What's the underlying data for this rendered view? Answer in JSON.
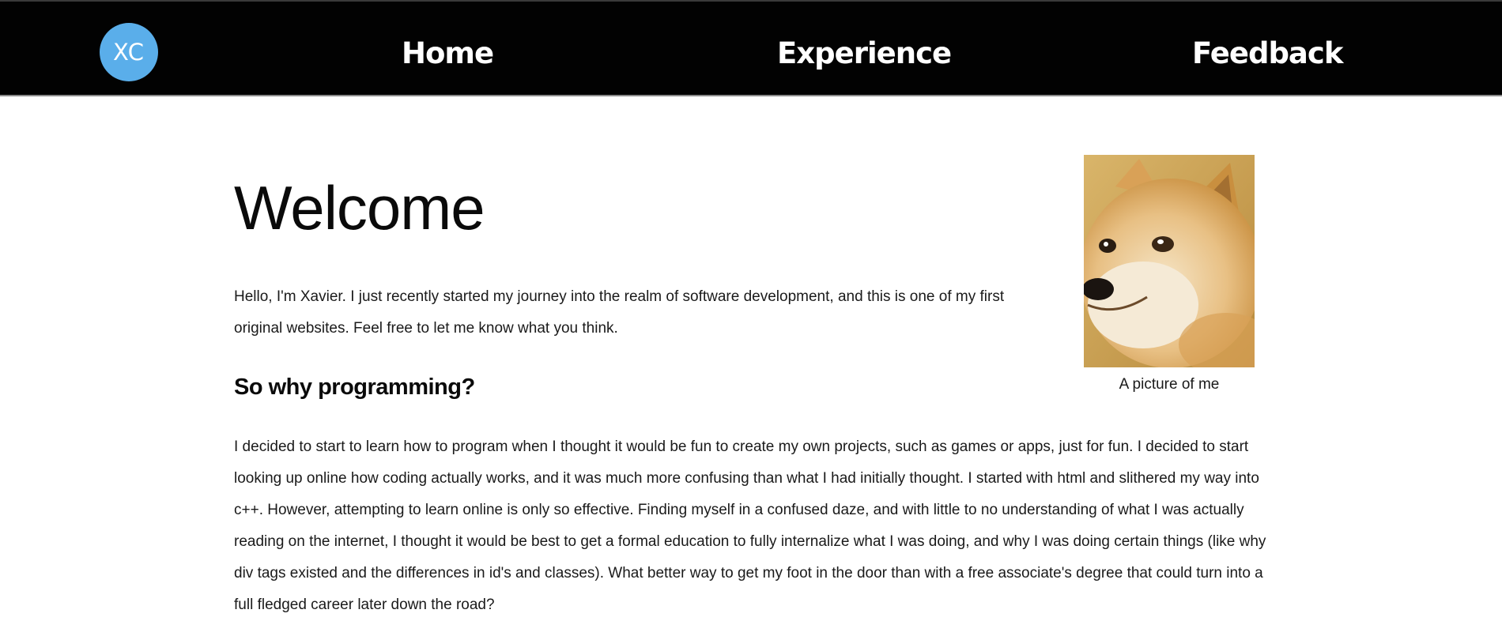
{
  "header": {
    "logo_text": "XC",
    "nav": {
      "home": "Home",
      "experience": "Experience",
      "feedback": "Feedback"
    }
  },
  "main": {
    "title": "Welcome",
    "intro": "Hello, I'm Xavier. I just recently started my journey into the realm of software development, and this is one of my first original websites. Feel free to let me know what you think.",
    "subheading": "So why programming?",
    "body": "I decided to start to learn how to program when I thought it would be fun to create my own projects, such as games or apps, just for fun. I decided to start looking up online how coding actually works, and it was much more confusing than what I had initially thought. I started with html and slithered my way into c++. However, attempting to learn online is only so effective. Finding myself in a confused daze, and with little to no understanding of what I was actually reading on the internet, I thought it would be best to get a formal education to fully internalize what I was doing, and why I was doing certain things (like why div tags existed and the differences in id's and classes). What better way to get my foot in the door than with a free associate's degree that could turn into a full fledged career later down the road?"
  },
  "photo": {
    "caption": "A picture of me"
  },
  "colors": {
    "header_bg": "#020202",
    "logo_bg": "#5aaeea",
    "text": "#1a1a1a"
  }
}
